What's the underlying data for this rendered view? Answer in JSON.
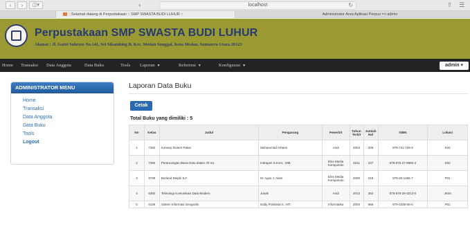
{
  "browser": {
    "url": "localhost",
    "tab1": "::Selamat datang di Perpustakaan :: SMP SWASTA BUDI LUHUR ::",
    "tab2": "Administrator Area Aplikasi Perpus => admin"
  },
  "header": {
    "title": "Perpustakaan SMP SWASTA BUDI LUHUR",
    "address": "Alamat : Jl. Gatot Subroto No.141, Sei Sikambing B, Kec. Medan Sunggal, Kota Medan, Sumatera Utara 20123"
  },
  "nav": {
    "items": [
      "Home",
      "Transaksi",
      "Data Anggota",
      "Data Buku",
      "Tools",
      "Laporan",
      "Referensi",
      "Konfigurasi"
    ],
    "user": "admin"
  },
  "sidebar": {
    "title": "ADMINISTRATOR MENU",
    "items": [
      "Home",
      "Transaksi",
      "Data Anggota",
      "Data Buku",
      "Tools",
      "Logout"
    ]
  },
  "main": {
    "title": "Laporan Data Buku",
    "print_button": "Cetak",
    "total_label": "Total Buku yang dimiliki : 5",
    "columns": [
      "No",
      "Kelas",
      "Judul",
      "Pengarang",
      "Penerbit",
      "Tahun Terbit",
      "Jumlah Hal",
      "ISBN",
      "Lokasi"
    ],
    "rows": [
      [
        "1",
        "7392",
        "Konsep Sistem Pakar",
        "Muhammad Arhami",
        "Andi",
        "2004",
        "205",
        "979-731-729-3",
        "K02"
      ],
      [
        "2",
        "7392",
        "Perancangan Basis Data dalam All In1",
        "Indrajani S.Kom., MM.",
        "Elex Media Kompuindo",
        "2011",
        "337",
        "978-979-27-9980-4",
        "K02"
      ],
      [
        "3",
        "9738",
        "Borland Delphi 5.0",
        "M. Agus J. Alam",
        "Elex Media Kompuindo",
        "2000",
        "215",
        "979-20-1466-7",
        "P01"
      ],
      [
        "4",
        "6392",
        "Teknologi Komunikasi Data Modern",
        "Jusak",
        "Andi",
        "2013",
        "362",
        "978-979-29-3213-0",
        "JK04"
      ],
      [
        "5",
        "6136",
        "Sistem Informasi Geografis",
        "Eddy Prahasta Ir., MT.",
        "Informatika",
        "2004",
        "666",
        "979-3338-06-0",
        "P01"
      ]
    ]
  }
}
